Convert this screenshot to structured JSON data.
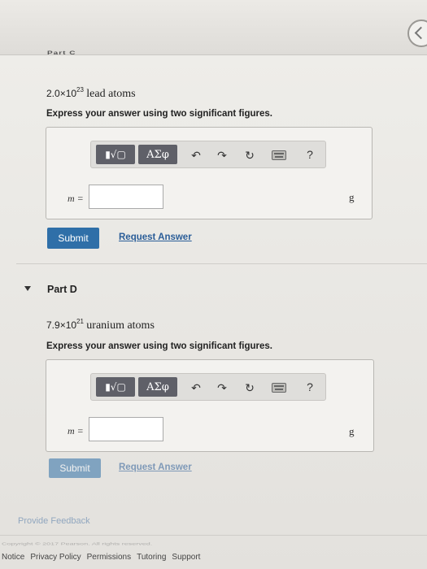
{
  "header": {
    "part_stub": "Part C"
  },
  "partC": {
    "coef": "2.0",
    "exp": "23",
    "substance": "lead atoms",
    "instruction": "Express your answer using two significant figures.",
    "variable_label": "m =",
    "unit": "g",
    "submit_label": "Submit",
    "request_label": "Request Answer"
  },
  "partD": {
    "title": "Part D",
    "coef": "7.9",
    "exp": "21",
    "substance": "uranium atoms",
    "instruction": "Express your answer using two significant figures.",
    "variable_label": "m =",
    "unit": "g",
    "submit_label": "Submit",
    "request_label": "Request Answer"
  },
  "toolbar": {
    "greek_label": "ΑΣφ",
    "help_label": "?"
  },
  "feedback_label": "Provide Feedback",
  "footer": {
    "copyright": "Copyright © 2017 Pearson. All rights reserved.",
    "links": [
      "Notice",
      "Privacy Policy",
      "Permissions",
      "Tutoring",
      "Support"
    ]
  },
  "colors": {
    "accent": "#2f6fa8",
    "link": "#2a5d98",
    "toolbar_button": "#5f6068"
  }
}
